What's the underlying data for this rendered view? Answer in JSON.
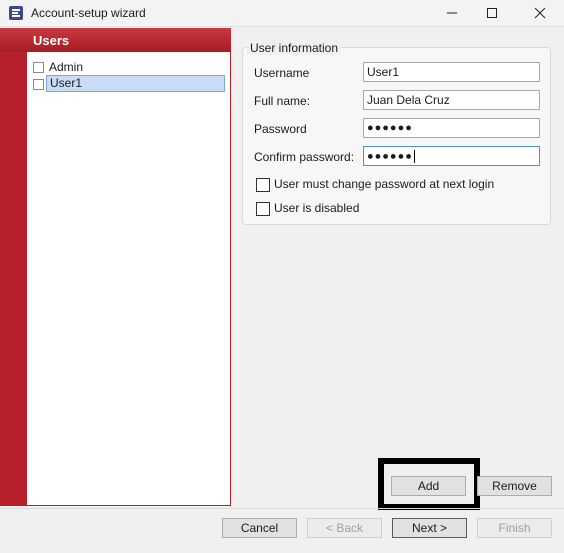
{
  "window": {
    "title": "Account-setup wizard",
    "controls": {
      "minimize": "minimize-icon",
      "maximize": "maximize-icon",
      "close": "close-icon"
    }
  },
  "users_panel": {
    "header": "Users",
    "items": [
      {
        "label": "Admin",
        "checked": false,
        "selected": false
      },
      {
        "label": "User1",
        "checked": false,
        "selected": true
      }
    ]
  },
  "user_info": {
    "legend": "User information",
    "fields": [
      {
        "label": "Username",
        "value": "User1"
      },
      {
        "label": "Full name:",
        "value": "Juan Dela Cruz"
      },
      {
        "label": "Password",
        "value": "●●●●●●"
      },
      {
        "label": "Confirm password:",
        "value": "●●●●●●"
      }
    ],
    "checkboxes": [
      {
        "label": "User must change password at next login",
        "checked": false
      },
      {
        "label": "User is disabled",
        "checked": false
      }
    ]
  },
  "actions": {
    "add": "Add",
    "remove": "Remove"
  },
  "navigation": {
    "cancel": "Cancel",
    "back": "< Back",
    "next": "Next >",
    "finish": "Finish"
  },
  "colors": {
    "accent": "#b5202a",
    "selection": "#c9dcf6",
    "focus_border": "#4f8fd8"
  }
}
